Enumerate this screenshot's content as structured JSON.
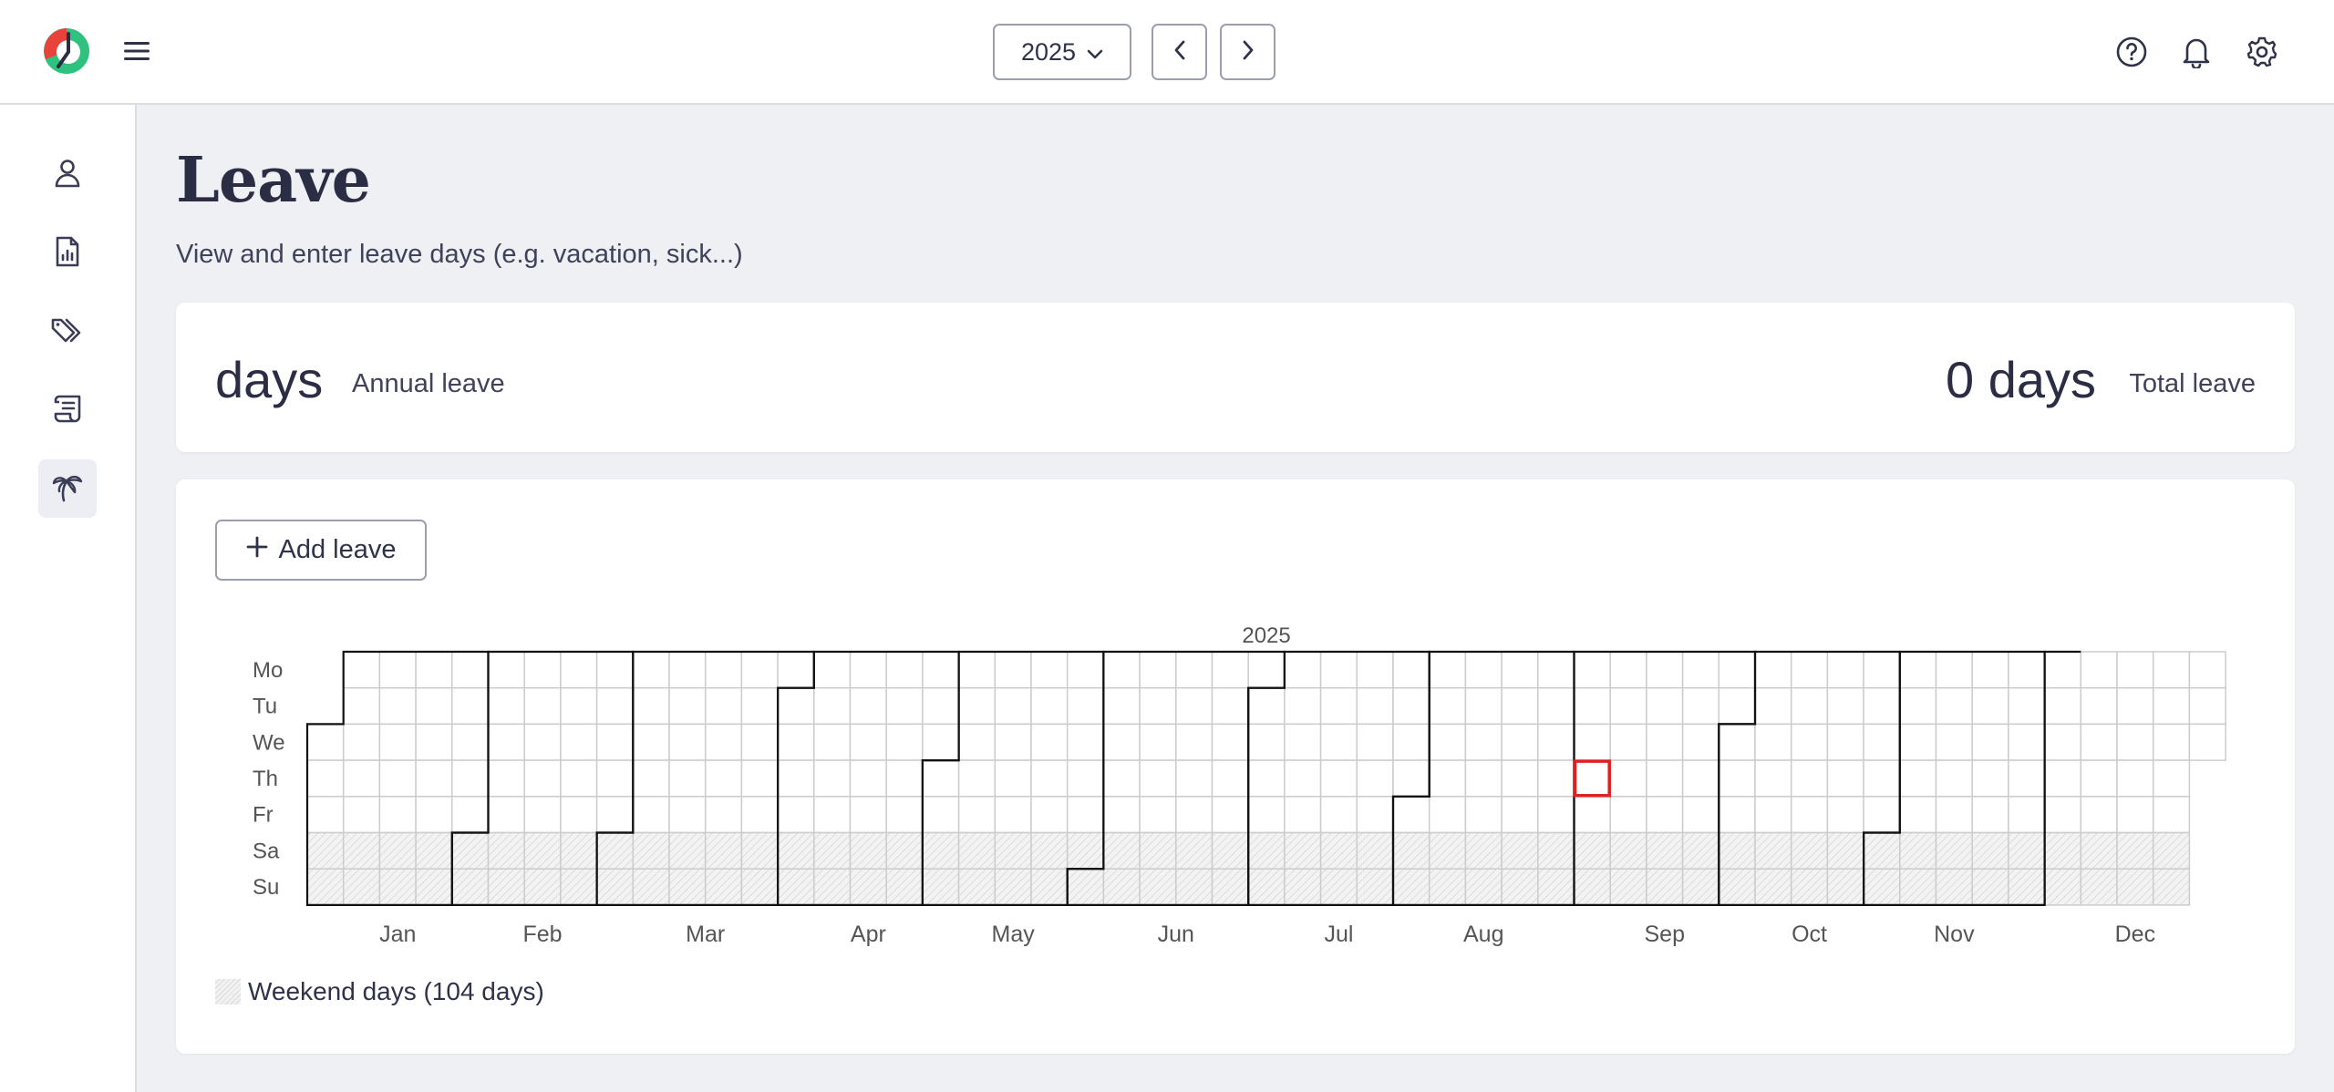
{
  "header": {
    "year": "2025",
    "colors": {
      "logo_red": "#e8423b",
      "logo_green": "#2ec27e"
    }
  },
  "sidebar": {
    "items": [
      {
        "icon": "user-icon",
        "active": false
      },
      {
        "icon": "report-icon",
        "active": false
      },
      {
        "icon": "tags-icon",
        "active": false
      },
      {
        "icon": "scroll-icon",
        "active": false
      },
      {
        "icon": "palm-tree-icon",
        "active": true
      }
    ]
  },
  "page": {
    "title": "Leave",
    "subtitle": "View and enter leave days (e.g. vacation, sick...)"
  },
  "summary": {
    "annual_value": "days",
    "annual_label": "Annual leave",
    "total_value": "0 days",
    "total_label": "Total leave"
  },
  "calendar": {
    "add_label": "Add leave",
    "year_label": "2025",
    "year": 2025,
    "today": "2025-09-04",
    "weekdays": [
      "Mo",
      "Tu",
      "We",
      "Th",
      "Fr",
      "Sa",
      "Su"
    ],
    "months": [
      "Jan",
      "Feb",
      "Mar",
      "Apr",
      "May",
      "Jun",
      "Jul",
      "Aug",
      "Sep",
      "Oct",
      "Nov",
      "Dec"
    ],
    "legend": "Weekend days (104 days)",
    "colors": {
      "today": "#e02020",
      "month_border": "#111111",
      "grid": "#cccccc"
    }
  }
}
